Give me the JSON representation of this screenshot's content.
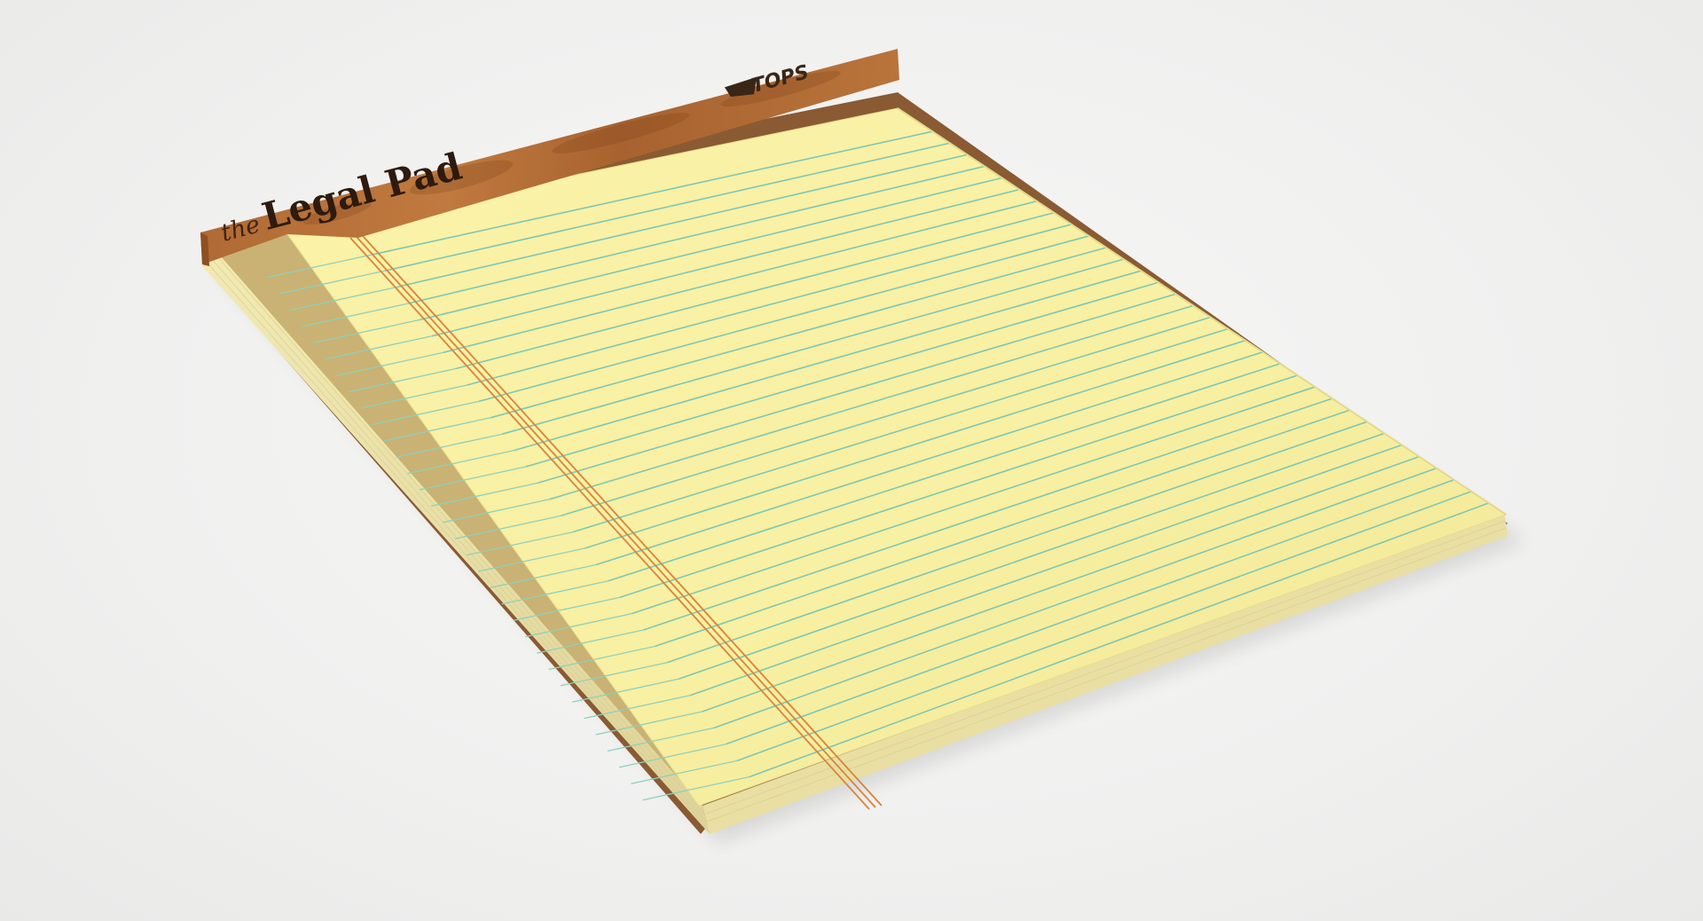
{
  "product": {
    "article": "the",
    "title": "Legal Pad",
    "brand": "TOPS"
  },
  "colors": {
    "background": "#f1f1f0",
    "paper": "#f7ef9f",
    "rule_line": "#7ec7b4",
    "margin_line": "#d8843c",
    "header_band": "#b46a33",
    "page_edges": "#efe7b0",
    "cardboard_back": "#8a5a33"
  }
}
